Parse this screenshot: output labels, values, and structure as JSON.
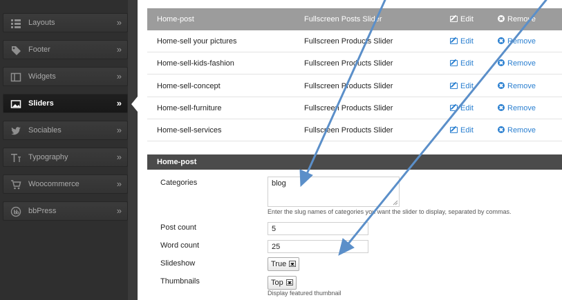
{
  "sidebar": {
    "items": [
      {
        "label": "Layouts",
        "icon": "list-icon",
        "active": false
      },
      {
        "label": "Footer",
        "icon": "tag-icon",
        "active": false
      },
      {
        "label": "Widgets",
        "icon": "window-icon",
        "active": false
      },
      {
        "label": "Sliders",
        "icon": "image-icon",
        "active": true
      },
      {
        "label": "Sociables",
        "icon": "twitter-bird-icon",
        "active": false
      },
      {
        "label": "Typography",
        "icon": "text-icon",
        "active": false
      },
      {
        "label": "Woocommerce",
        "icon": "cart-icon",
        "active": false
      },
      {
        "label": "bbPress",
        "icon": "bbpress-logo-icon",
        "active": false
      }
    ],
    "chevron": "»"
  },
  "sliders": {
    "edit_label": "Edit",
    "remove_label": "Remove",
    "rows": [
      {
        "name": "Home-post",
        "type": "Fullscreen Posts Slider",
        "selected": true
      },
      {
        "name": "Home-sell your pictures",
        "type": "Fullscreen Products Slider",
        "selected": false
      },
      {
        "name": "Home-sell-kids-fashion",
        "type": "Fullscreen Products Slider",
        "selected": false
      },
      {
        "name": "Home-sell-concept",
        "type": "Fullscreen Products Slider",
        "selected": false
      },
      {
        "name": "Home-sell-furniture",
        "type": "Fullscreen Products Slider",
        "selected": false
      },
      {
        "name": "Home-sell-services",
        "type": "Fullscreen Products Slider",
        "selected": false
      }
    ]
  },
  "panel": {
    "title": "Home-post",
    "categories": {
      "label": "Categories",
      "value": "blog",
      "hint": "Enter the slug names of categories you want the slider to display, separated by commas."
    },
    "post_count": {
      "label": "Post count",
      "value": "5"
    },
    "word_count": {
      "label": "Word count",
      "value": "25"
    },
    "slideshow": {
      "label": "Slideshow",
      "value": "True"
    },
    "thumbnails": {
      "label": "Thumbnails",
      "value": "Top",
      "hint": "Display featured thumbnail"
    }
  },
  "colors": {
    "sidebar_bg": "#2f2f2f",
    "selected_row": "#9c9c9c",
    "panel_header": "#4b4b4b",
    "link": "#2a7fd0",
    "annotation_arrow": "#5b8fc9"
  }
}
